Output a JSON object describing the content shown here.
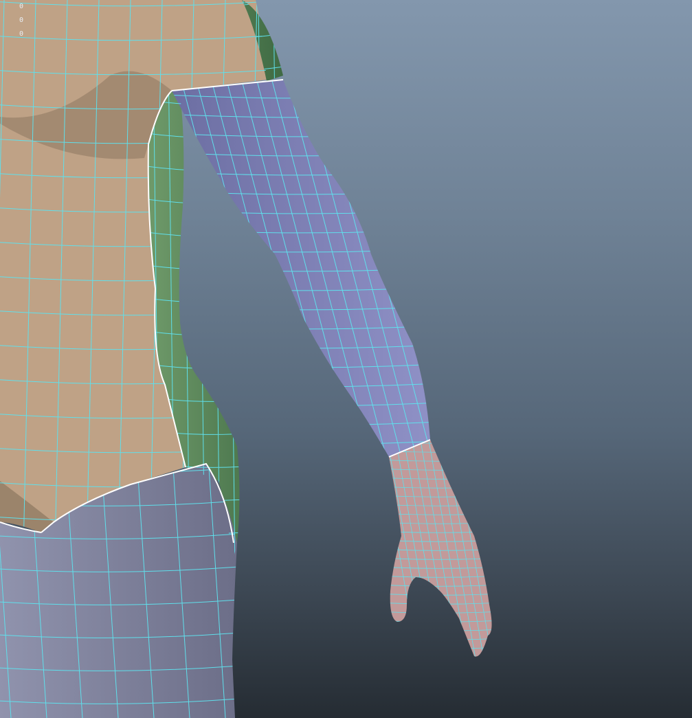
{
  "hud": {
    "readouts": [
      "0",
      "0",
      "0"
    ]
  },
  "materials": {
    "torso": "#bfa286",
    "torso_shadow": "#8c7760",
    "side_strip": "#6f9a6a",
    "side_strip_dark": "#3f6a43",
    "arm": "#8f91c6",
    "arm_shadow": "#6c6ea2",
    "hand": "#c29a9a",
    "legs": "#9093ad",
    "legs_shadow": "#6c6e88",
    "wire": "#5fe0ec",
    "border": "#ffffff"
  }
}
